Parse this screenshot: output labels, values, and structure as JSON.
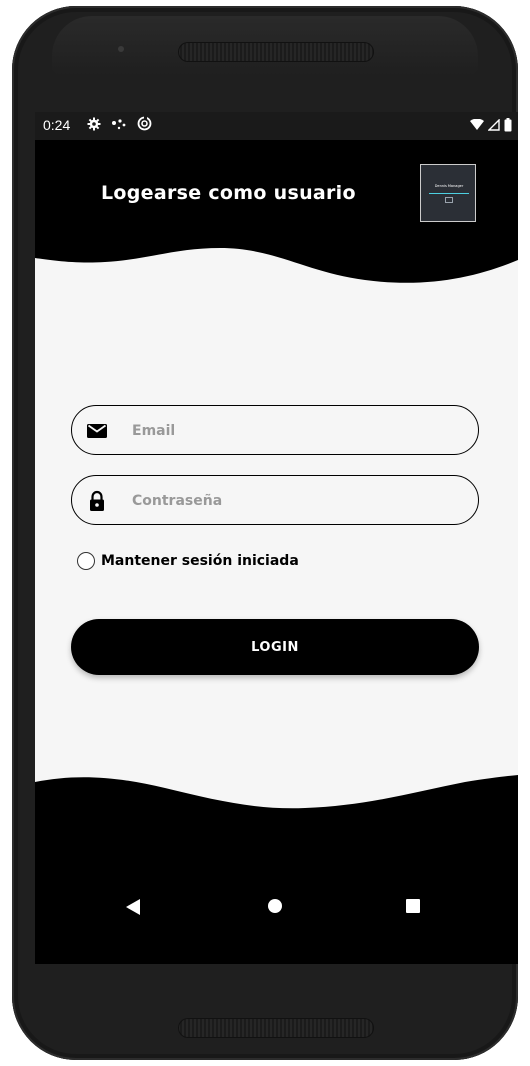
{
  "status_bar": {
    "time": "0:24",
    "left_icons": [
      "gear-icon",
      "dots-icon",
      "sync-icon"
    ],
    "right_icons": [
      "wifi-icon",
      "signal-icon",
      "battery-icon"
    ]
  },
  "header": {
    "title": "Logearse como usuario",
    "logo": {
      "text": "Dennis Manager",
      "accent": "#4dd0e1"
    }
  },
  "form": {
    "email": {
      "icon": "mail-icon",
      "placeholder": "Email",
      "value": ""
    },
    "password": {
      "icon": "lock-icon",
      "placeholder": "Contraseña",
      "value": ""
    },
    "remember": {
      "label": "Mantener sesión iniciada",
      "checked": false
    },
    "login_label": "LOGIN"
  },
  "nav_bar": {
    "buttons": [
      "back-icon",
      "home-icon",
      "recents-icon"
    ]
  },
  "colors": {
    "background": "#f6f6f6",
    "dark": "#000000",
    "text_light": "#ffffff",
    "placeholder": "#999999"
  }
}
